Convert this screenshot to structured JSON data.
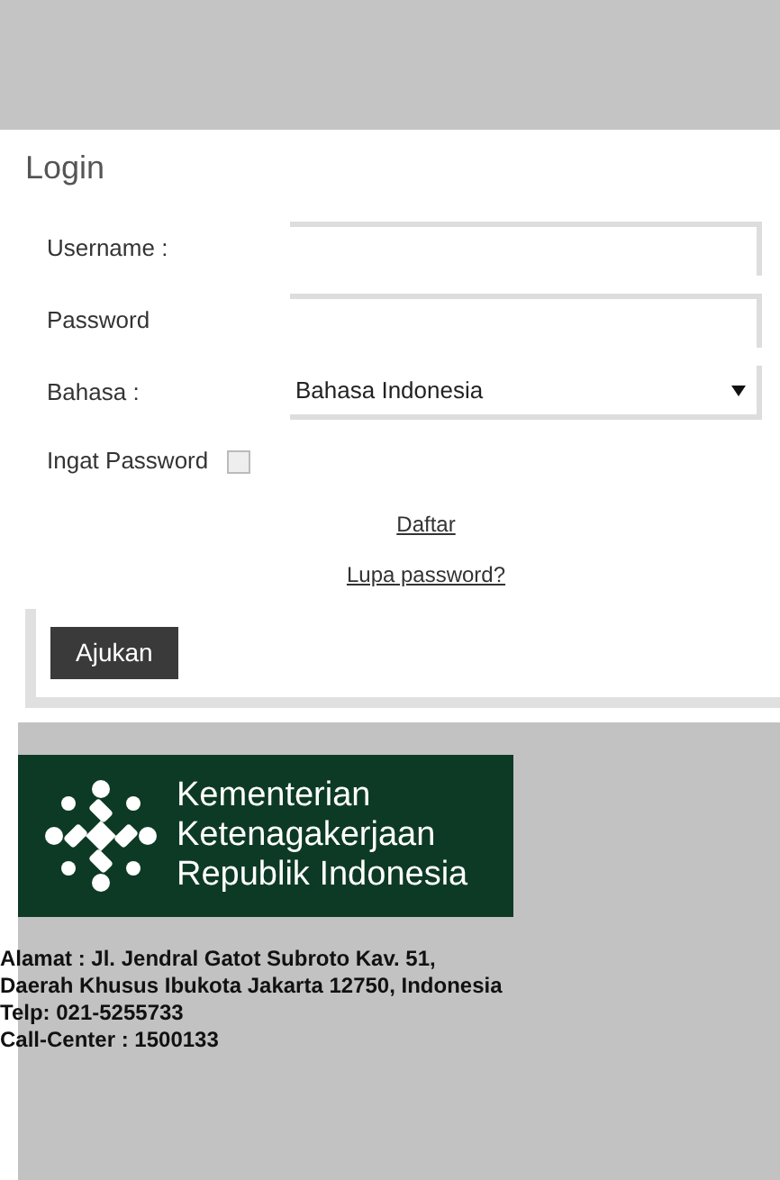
{
  "login": {
    "title": "Login",
    "fields": [
      {
        "kind": "text",
        "label": "Username :"
      },
      {
        "kind": "password",
        "label": "Password"
      },
      {
        "kind": "select",
        "label": "Bahasa :",
        "value": "Bahasa Indonesia"
      },
      {
        "kind": "checkbox",
        "label": "Ingat Password",
        "checked": false
      }
    ],
    "links": [
      "Daftar",
      "Lupa password?"
    ],
    "submit": "Ajukan"
  },
  "footer": {
    "logo_lines": [
      "Kementerian",
      "Ketenagakerjaan",
      "Republik Indonesia"
    ],
    "address": [
      "Alamat : Jl. Jendral Gatot Subroto Kav. 51,",
      "Daerah Khusus Ibukota Jakarta 12750, Indonesia",
      "Telp: 021-5255733",
      "Call-Center : 1500133"
    ]
  }
}
